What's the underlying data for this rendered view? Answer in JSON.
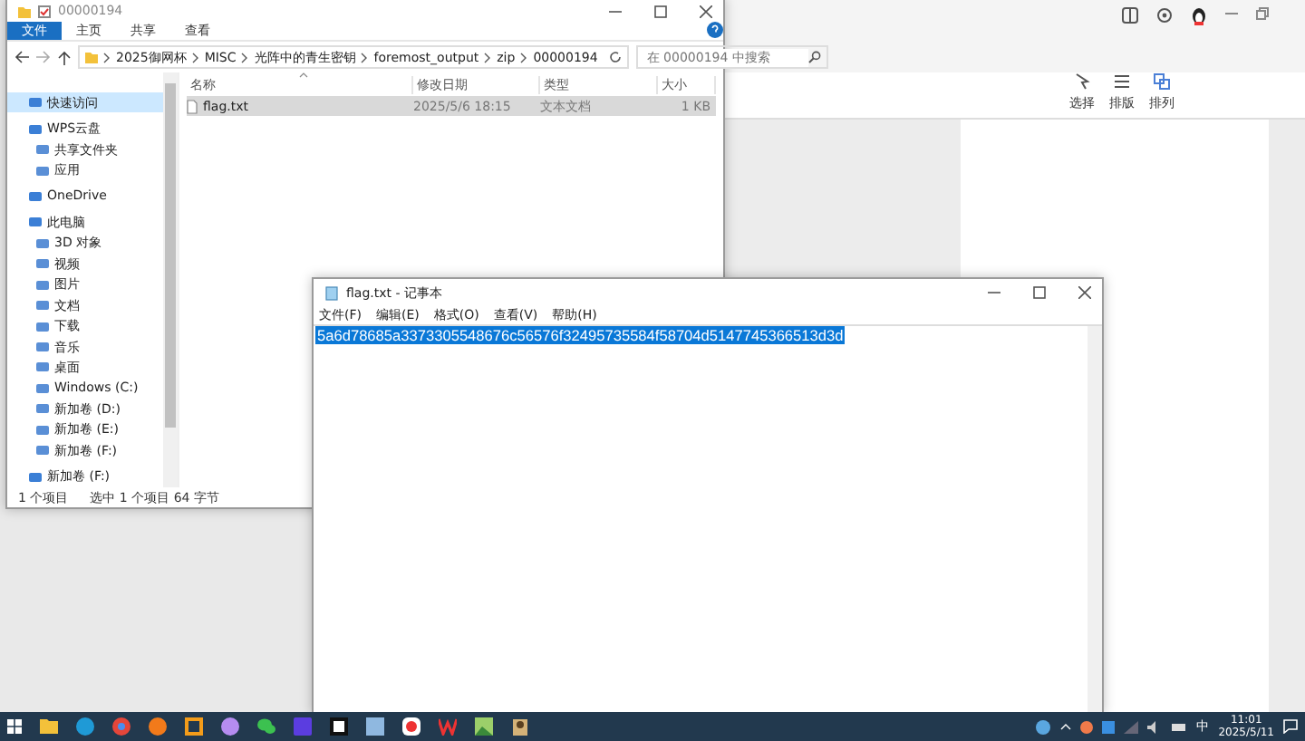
{
  "background_app": {
    "tools": [
      {
        "label": "选择"
      },
      {
        "label": "排版"
      },
      {
        "label": "排列"
      }
    ]
  },
  "explorer": {
    "title": "00000194",
    "ribbon_tabs": [
      {
        "label": "文件",
        "selected": true
      },
      {
        "label": "主页",
        "selected": false
      },
      {
        "label": "共享",
        "selected": false
      },
      {
        "label": "查看",
        "selected": false
      }
    ],
    "breadcrumb": [
      "2025御网杯",
      "MISC",
      "光阵中的青生密钥",
      "foremost_output",
      "zip",
      "00000194"
    ],
    "search": {
      "placeholder": "在 00000194 中搜索"
    },
    "sidebar": {
      "items": [
        {
          "label": "快速访问",
          "selected": true
        },
        {
          "label": "WPS云盘",
          "selected": false,
          "children": [
            {
              "label": "共享文件夹",
              "selected": false
            },
            {
              "label": "应用",
              "selected": false
            }
          ]
        },
        {
          "label": "OneDrive",
          "selected": false
        },
        {
          "label": "此电脑",
          "selected": false,
          "children": [
            {
              "label": "3D 对象",
              "selected": false
            },
            {
              "label": "视频",
              "selected": false
            },
            {
              "label": "图片",
              "selected": false
            },
            {
              "label": "文档",
              "selected": false
            },
            {
              "label": "下载",
              "selected": false
            },
            {
              "label": "音乐",
              "selected": false
            },
            {
              "label": "桌面",
              "selected": false
            },
            {
              "label": "Windows (C:)",
              "selected": false
            },
            {
              "label": "新加卷 (D:)",
              "selected": false
            },
            {
              "label": "新加卷 (E:)",
              "selected": false
            },
            {
              "label": "新加卷 (F:)",
              "selected": false
            }
          ]
        },
        {
          "label": "新加卷 (F:)",
          "selected": false
        }
      ]
    },
    "table": {
      "columns": [
        "名称",
        "修改日期",
        "类型",
        "大小"
      ],
      "rows": [
        {
          "name": "flag.txt",
          "modified": "2025/5/6 18:15",
          "type": "文本文档",
          "size": "1 KB",
          "selected": true
        }
      ]
    },
    "status_bar": [
      "1 个项目",
      "选中 1 个项目  64 字节"
    ]
  },
  "notepad": {
    "title": "flag.txt - 记事本",
    "menus": [
      "文件(F)",
      "编辑(E)",
      "格式(O)",
      "查看(V)",
      "帮助(H)"
    ],
    "content": {
      "text": "5a6d78685a3373305548676c56576f32495735584f58704d5147745366513d3d",
      "selected": true
    }
  },
  "taskbar": {
    "time": "11:01",
    "date": "2025/5/11",
    "ime": "中"
  }
}
